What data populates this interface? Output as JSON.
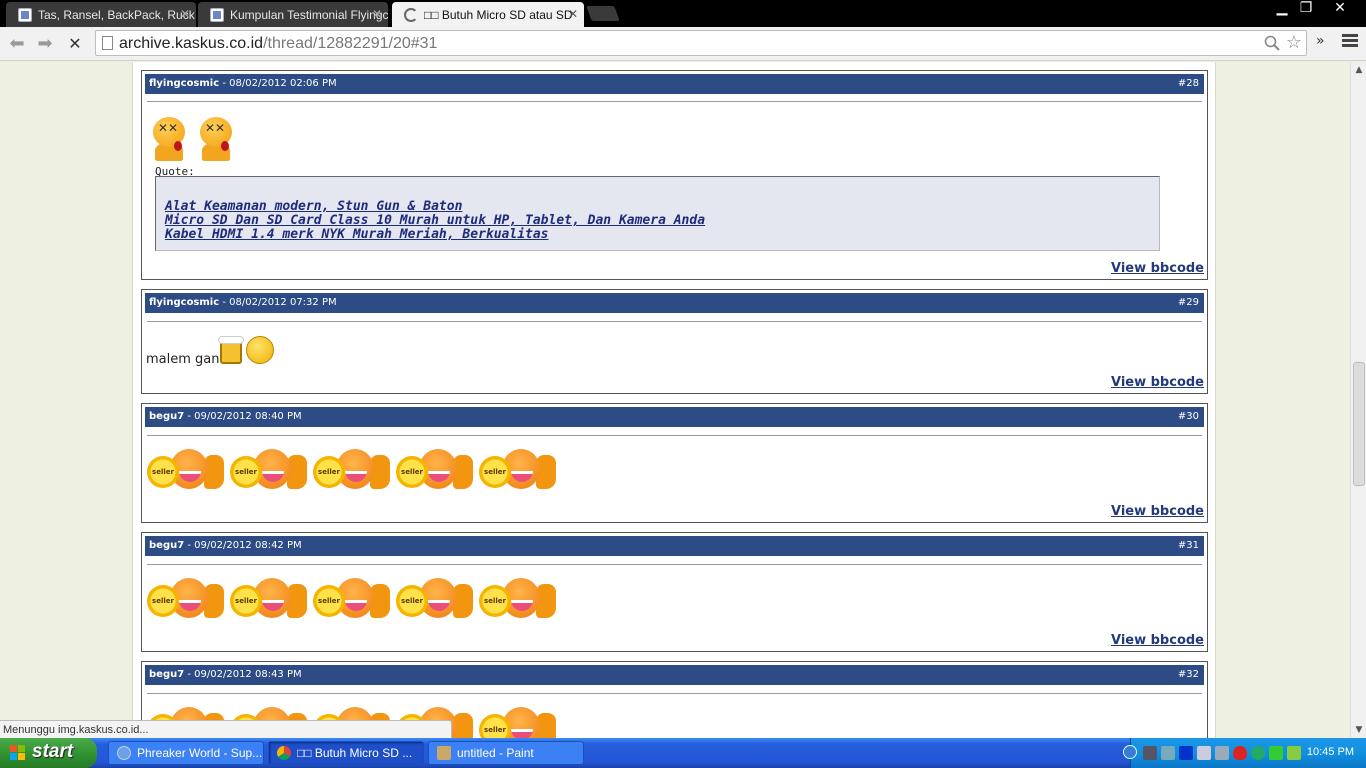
{
  "browser": {
    "tabs": [
      {
        "title": "Tas, Ransel, BackPack, Ruck"
      },
      {
        "title": "Kumpulan Testimonial Flyingc"
      },
      {
        "title": "□□ Butuh Micro SD atau SD"
      }
    ],
    "url_host": "archive.kaskus.co.id",
    "url_path": "/thread/12882291/20#31",
    "status_text": "Menunggu img.kaskus.co.id..."
  },
  "posts": [
    {
      "author": "flyingcosmic",
      "date": "- 08/02/2012 02:06 PM",
      "number": "#28",
      "quote_label": "Quote:",
      "quote_links": [
        "Alat Keamanan modern, Stun Gun & Baton",
        "Micro SD Dan SD Card Class 10 Murah untuk HP, Tablet, Dan Kamera Anda",
        "Kabel HDMI 1.4 merk NYK Murah Meriah, Berkualitas"
      ],
      "view_bbcode": "View bbcode"
    },
    {
      "author": "flyingcosmic",
      "date": "- 08/02/2012 07:32 PM",
      "number": "#29",
      "text": "malem gan",
      "view_bbcode": "View bbcode"
    },
    {
      "author": "begu7",
      "date": "- 09/02/2012 08:40 PM",
      "number": "#30",
      "view_bbcode": "View bbcode"
    },
    {
      "author": "begu7",
      "date": "- 09/02/2012 08:42 PM",
      "number": "#31",
      "view_bbcode": "View bbcode"
    },
    {
      "author": "begu7",
      "date": "- 09/02/2012 08:43 PM",
      "number": "#32"
    }
  ],
  "emoticon_label": "seller",
  "taskbar": {
    "start_label": "start",
    "tasks": [
      {
        "label": "Phreaker World - Sup..."
      },
      {
        "label": "□□ Butuh Micro SD ..."
      },
      {
        "label": "untitled - Paint"
      }
    ],
    "clock": "10:45 PM"
  },
  "colors": {
    "post_header": "#2d4c85",
    "taskbar": "#245edb",
    "start_green": "#2f8f2f"
  }
}
